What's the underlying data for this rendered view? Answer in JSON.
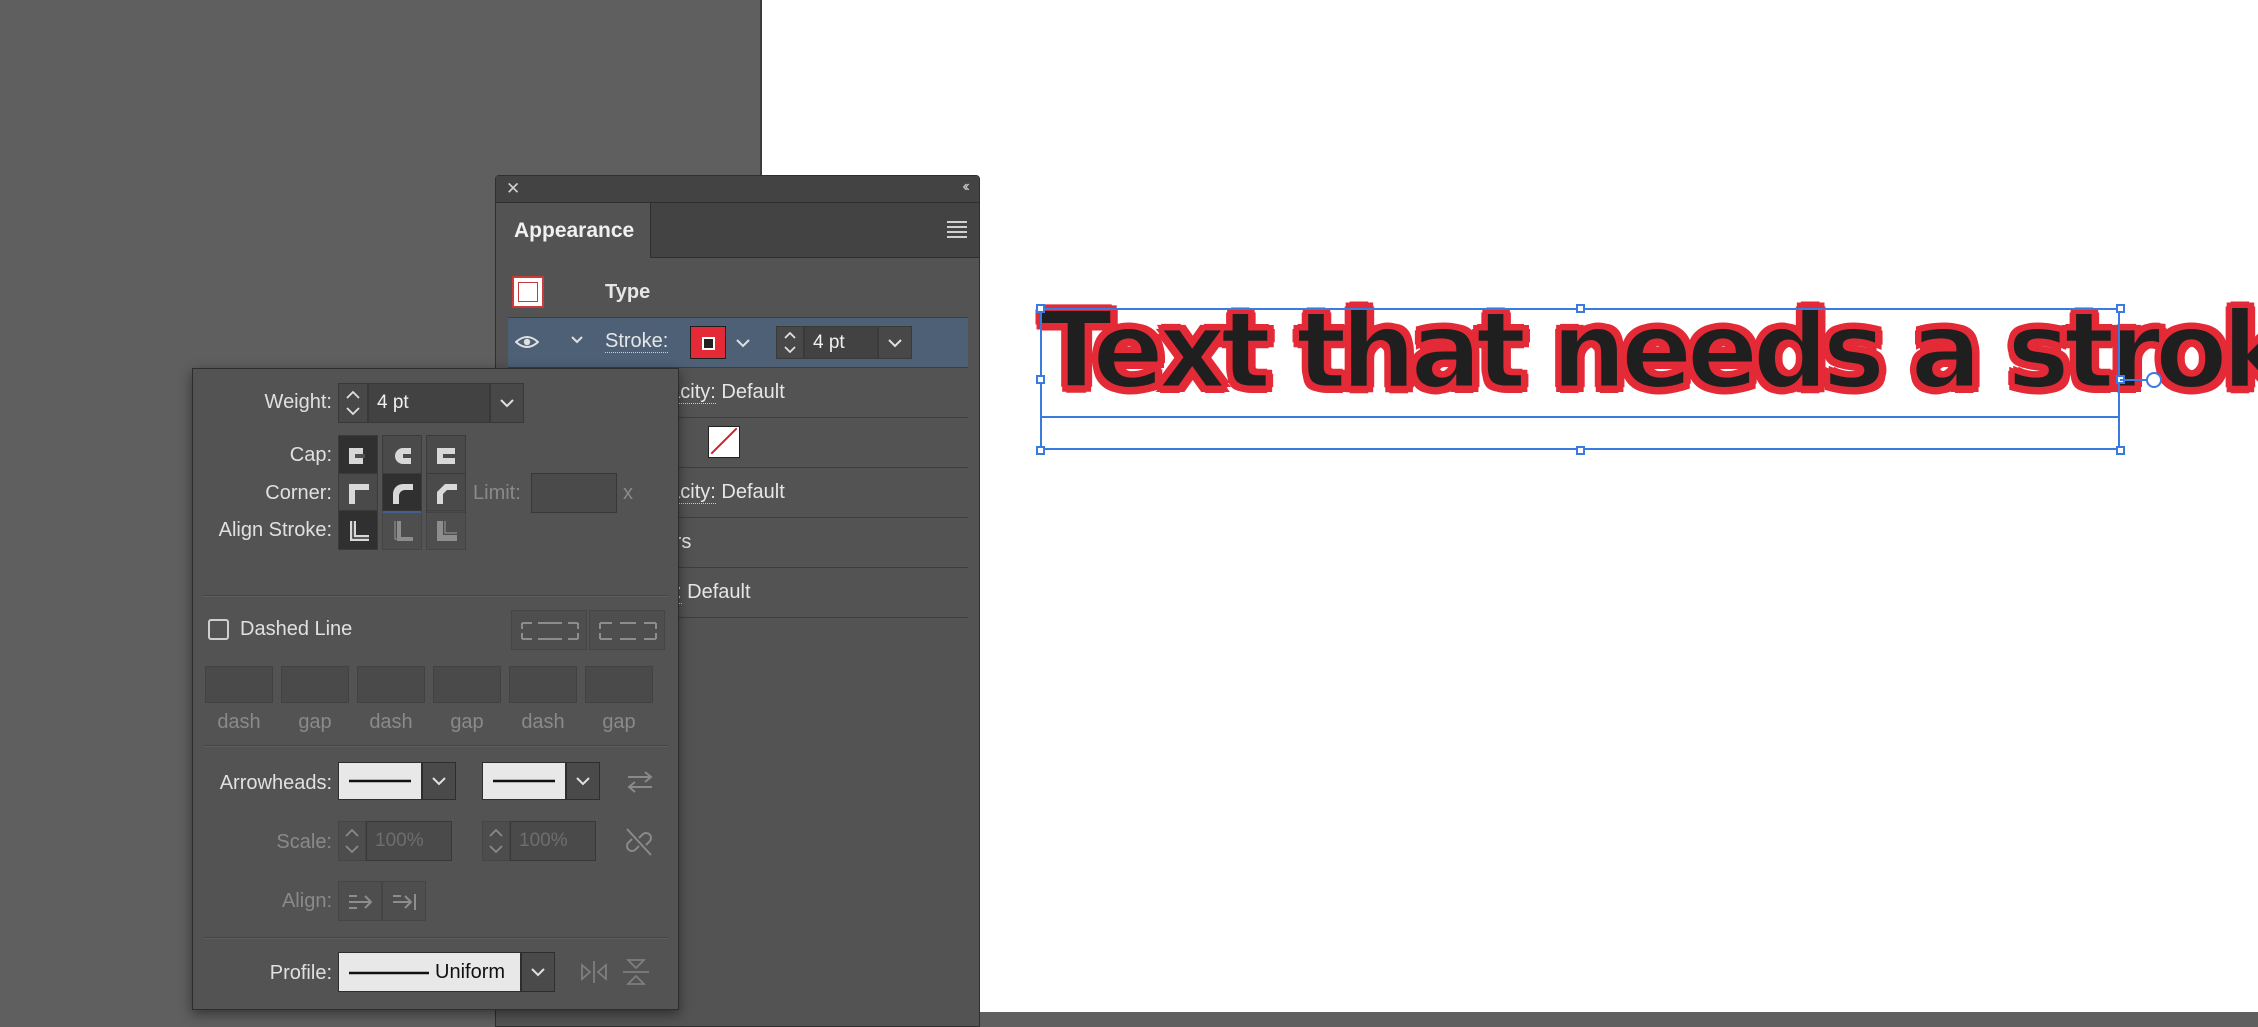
{
  "canvas": {
    "art_text": "Text that needs a stroke",
    "fill_color": "#1f1f1f",
    "stroke_color": "#e32a36",
    "selection_color": "#3a7be0"
  },
  "appearance": {
    "tab_label": "Appearance",
    "rows": {
      "type_label": "Type",
      "stroke_label": "Stroke:",
      "stroke_weight": "4 pt",
      "opacity1_partial": "pacity:",
      "opacity1_value": "Default",
      "opacity2_partial": "pacity:",
      "opacity2_value": "Default",
      "characters_partial": "ters",
      "opacity3_partial": "y:",
      "opacity3_value": "Default"
    }
  },
  "stroke_panel": {
    "weight_label": "Weight:",
    "weight_value": "4 pt",
    "cap_label": "Cap:",
    "corner_label": "Corner:",
    "limit_label": "Limit:",
    "limit_suffix": "x",
    "align_stroke_label": "Align Stroke:",
    "dashed_line_label": "Dashed Line",
    "dash_labels": [
      "dash",
      "gap",
      "dash",
      "gap",
      "dash",
      "gap"
    ],
    "arrowheads_label": "Arrowheads:",
    "scale_label": "Scale:",
    "scale_start": "100%",
    "scale_end": "100%",
    "align_label": "Align:",
    "profile_label": "Profile:",
    "profile_value": "Uniform"
  }
}
